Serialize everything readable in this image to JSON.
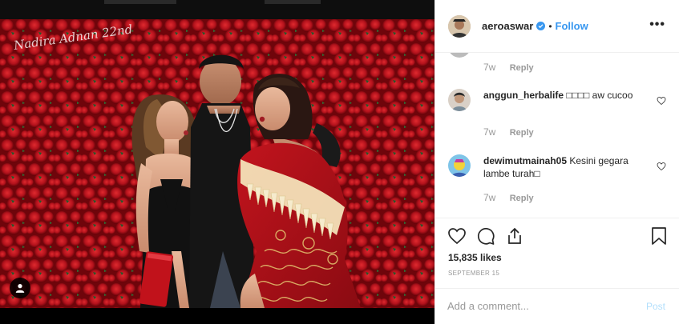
{
  "post": {
    "username": "aeroaswar",
    "follow_label": "Follow",
    "separator": "•",
    "photo_signature": "Nadira Adnan 22nd",
    "likes": "15,835 likes",
    "date": "SEPTEMBER 15",
    "add_comment_placeholder": "Add a comment...",
    "post_label": "Post"
  },
  "comments": [
    {
      "username": "",
      "text": "",
      "time": "7w",
      "reply_label": "Reply"
    },
    {
      "username": "anggun_herbalife",
      "text": "□□□□ aw cucoo",
      "time": "7w",
      "reply_label": "Reply"
    },
    {
      "username": "dewimutmainah05",
      "text": "Kesini gegara lambe turah□",
      "time": "7w",
      "reply_label": "Reply"
    }
  ],
  "colors": {
    "accent": "#3897f0",
    "post_disabled": "#b2dffc",
    "rose_red": "#b3121c",
    "rose_dark": "#5e0207"
  },
  "icons": [
    "heart-icon",
    "comment-icon",
    "share-icon",
    "bookmark-icon",
    "more-icon",
    "user-tag-icon",
    "verified-badge-icon"
  ]
}
